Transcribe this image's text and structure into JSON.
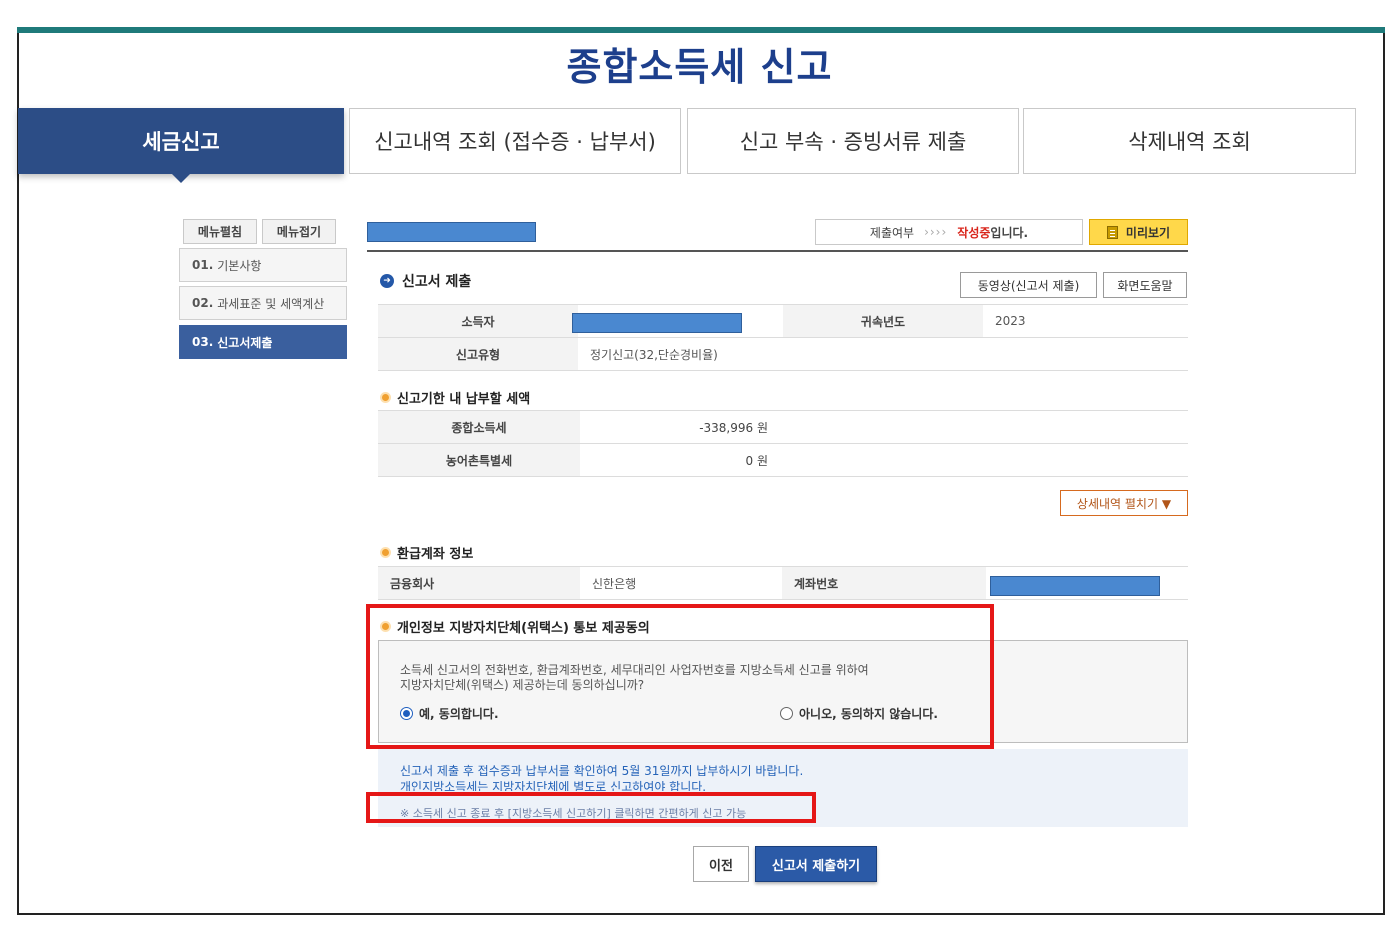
{
  "page": {
    "title": "종합소득세 신고"
  },
  "tabs": [
    {
      "label": "세금신고",
      "active": true
    },
    {
      "label": "신고내역 조회 (접수증 · 납부서)"
    },
    {
      "label": "신고 부속 · 증빙서류 제출"
    },
    {
      "label": "삭제내역 조회"
    }
  ],
  "sidebar": {
    "expand_label": "메뉴펼침",
    "collapse_label": "메뉴접기",
    "items": [
      {
        "num": "01.",
        "label": "기본사항"
      },
      {
        "num": "02.",
        "label": "과세표준 및 세액계산"
      },
      {
        "num": "03.",
        "label": "신고서제출",
        "active": true
      }
    ]
  },
  "status": {
    "label": "제출여부",
    "arrows": "››››",
    "state": "작성중",
    "suffix": "입니다.",
    "preview_label": "미리보기"
  },
  "section": {
    "title": "신고서 제출",
    "video_button": "동영상(신고서 제출)",
    "help_button": "화면도움말"
  },
  "info_table": {
    "taxpayer_label": "소득자",
    "year_label": "귀속년도",
    "year_value": "2023",
    "type_label": "신고유형",
    "type_value": "정기신고(32,단순경비율)"
  },
  "payment": {
    "title": "신고기한 내 납부할 세액",
    "rows": [
      {
        "label": "종합소득세",
        "value": "-338,996 원"
      },
      {
        "label": "농어촌특별세",
        "value": "0 원"
      }
    ],
    "expand_button": "상세내역 펼치기 ▼"
  },
  "refund": {
    "title": "환급계좌 정보",
    "bank_label": "금융회사",
    "bank_value": "신한은행",
    "account_label": "계좌번호"
  },
  "consent": {
    "title": "개인정보 지방자치단체(위택스) 통보 제공동의",
    "text_line1": "소득세 신고서의 전화번호, 환급계좌번호, 세무대리인 사업자번호를 지방소득세 신고를 위하여",
    "text_line2": "지방자치단체(위택스) 제공하는데 동의하십니까?",
    "yes_label": "예, 동의합니다.",
    "no_label": "아니오, 동의하지 않습니다."
  },
  "notice": {
    "line1": "신고서 제출 후 접수증과 납부서를 확인하여 5월 31일까지 납부하시기 바랍니다.",
    "line2": "개인지방소득세는 지방자치단체에 별도로 신고하여야 합니다.",
    "line3": "※ 소득세 신고 종료 후 [지방소득세 신고하기] 클릭하면 간편하게 신고 가능"
  },
  "buttons": {
    "prev": "이전",
    "submit": "신고서 제출하기"
  },
  "colors": {
    "primary": "#2c4d86",
    "accent_red": "#e51717",
    "redaction": "#4a88d0"
  }
}
